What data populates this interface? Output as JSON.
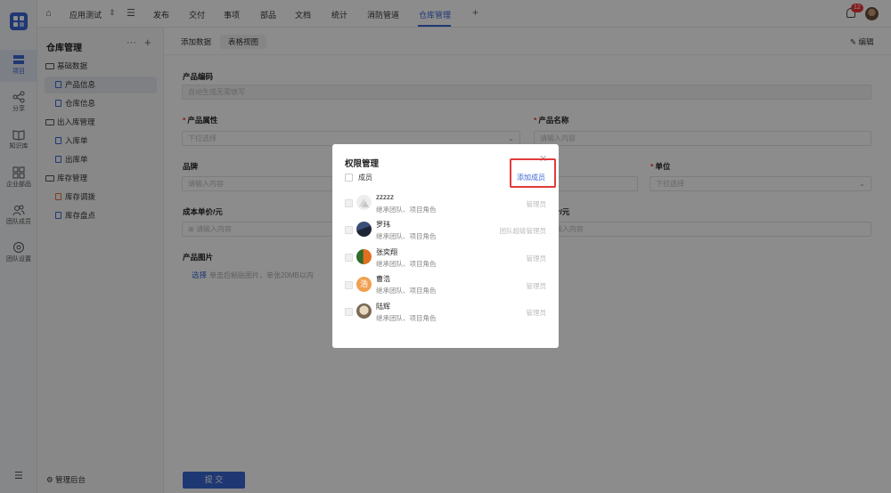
{
  "topbar": {
    "app_name": "应用测试",
    "nav": [
      "发布",
      "交付",
      "事项",
      "部品",
      "文档",
      "统计",
      "消防管道",
      "仓库管理"
    ],
    "active_nav": "仓库管理",
    "notification_count": "12"
  },
  "rail": {
    "items": [
      {
        "label": "项目",
        "icon": "project-icon"
      },
      {
        "label": "分享",
        "icon": "share-icon"
      },
      {
        "label": "知识库",
        "icon": "book-icon"
      },
      {
        "label": "企业部品",
        "icon": "grid-icon"
      },
      {
        "label": "团队成员",
        "icon": "team-icon"
      },
      {
        "label": "团队设置",
        "icon": "settings-icon"
      }
    ]
  },
  "side": {
    "title": "仓库管理",
    "more": "···",
    "add": "+",
    "groups": [
      {
        "label": "基础数据",
        "items": [
          "产品信息",
          "仓库信息"
        ]
      },
      {
        "label": "出入库管理",
        "items": [
          "入库单",
          "出库单"
        ]
      },
      {
        "label": "库存管理",
        "items": [
          "库存调拨",
          "库存盘点"
        ]
      }
    ],
    "footer": "管理后台"
  },
  "tabs": {
    "items": [
      "添加数据",
      "表格视图"
    ],
    "edit": "编辑"
  },
  "form": {
    "code_label": "产品编码",
    "code_placeholder": "自动生成无需填写",
    "attr_label": "产品属性",
    "attr_placeholder": "下拉选择",
    "name_label": "产品名称",
    "name_placeholder": "请输入内容",
    "brand_label": "品牌",
    "brand_placeholder": "请输入内容",
    "unit_label": "单位",
    "unit_placeholder": "下拉选择",
    "cost_label": "成本单价/元",
    "cost_placeholder": "请输入内容",
    "price_label_partial": "价/元",
    "price_placeholder": "请输入内容",
    "image_label": "产品图片",
    "upload_link": "选择",
    "upload_hint": "单击后粘贴图片，单张20MB以内",
    "submit": "提 交"
  },
  "modal": {
    "title": "权限管理",
    "close": "✕",
    "members_label": "成员",
    "add_member": "添加成员",
    "members": [
      {
        "name": "zzzzz",
        "sub": "继承团队、项目角色",
        "role": "管理员"
      },
      {
        "name": "罗玮",
        "sub": "继承团队、项目角色",
        "role": "团队超级管理员"
      },
      {
        "name": "张奕翔",
        "sub": "继承团队、项目角色",
        "role": "管理员"
      },
      {
        "name": "曹浩",
        "sub": "继承团队、项目角色",
        "role": "管理员",
        "avatar_text": "浩"
      },
      {
        "name": "陆辉",
        "sub": "继承团队、项目角色",
        "role": "管理员"
      }
    ]
  },
  "colors": {
    "accent": "#3a66d4",
    "highlight_box": "#e23b3b",
    "badge": "#ee3333"
  }
}
